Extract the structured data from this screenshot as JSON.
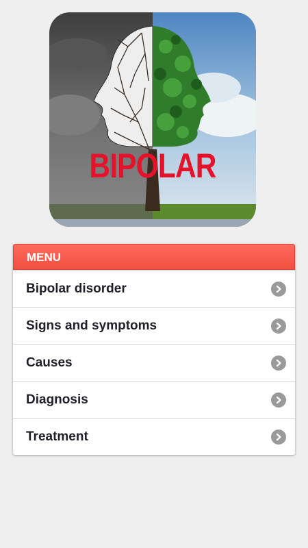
{
  "hero": {
    "word": "BIPOLAR",
    "image": "bipolar-tree-head-illustration"
  },
  "menu": {
    "header": "MENU",
    "items": [
      {
        "label": "Bipolar disorder"
      },
      {
        "label": "Signs and symptoms"
      },
      {
        "label": "Causes"
      },
      {
        "label": "Diagnosis"
      },
      {
        "label": "Treatment"
      }
    ],
    "chevron_icon": "chevron-right-icon"
  },
  "colors": {
    "background": "#efefef",
    "header": "#f55a4a",
    "title_red": "#e4122b",
    "chevron": "#9a9a9a"
  }
}
